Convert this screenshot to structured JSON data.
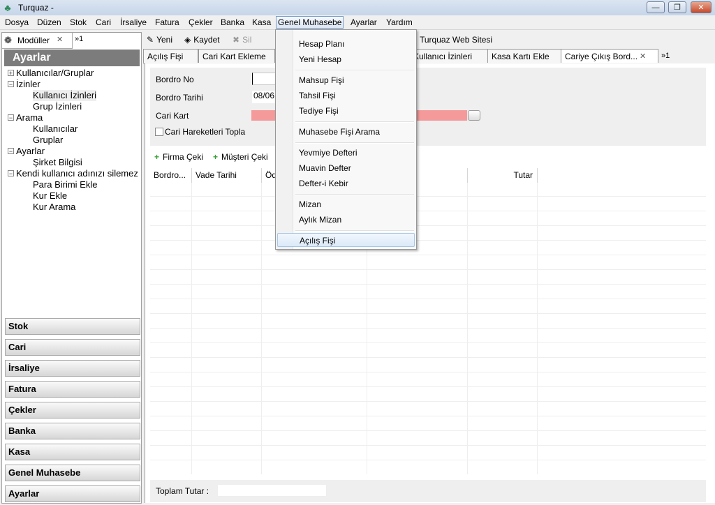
{
  "window": {
    "title": "Turquaz -",
    "minimize": "—",
    "maximize": "❐",
    "close": "✕"
  },
  "menubar": [
    "Dosya",
    "Düzen",
    "Stok",
    "Cari",
    "İrsaliye",
    "Fatura",
    "Çekler",
    "Banka",
    "Kasa",
    "Genel Muhasebe",
    "Ayarlar",
    "Yardım"
  ],
  "left": {
    "tab_label": "Modüller",
    "tab_overflow": "»1",
    "header": "Ayarlar",
    "tree": [
      {
        "label": "Kullanıcılar/Gruplar",
        "expander": "+"
      },
      {
        "label": "İzinler",
        "expander": "−"
      },
      {
        "label": "Kullanıcı İzinleri"
      },
      {
        "label": "Grup İzinleri"
      },
      {
        "label": "Arama",
        "expander": "−"
      },
      {
        "label": "Kullanıcılar"
      },
      {
        "label": "Gruplar"
      },
      {
        "label": "Ayarlar",
        "expander": "−"
      },
      {
        "label": "Şirket Bilgisi"
      },
      {
        "label": "Kendi kullanıcı adınızı silemez",
        "expander": "−"
      },
      {
        "label": "Para Birimi Ekle"
      },
      {
        "label": "Kur Ekle"
      },
      {
        "label": "Kur Arama"
      }
    ],
    "categories": [
      "Stok",
      "Cari",
      "İrsaliye",
      "Fatura",
      "Çekler",
      "Banka",
      "Kasa",
      "Genel Muhasebe",
      "Ayarlar"
    ]
  },
  "toolbar": {
    "new": "Yeni",
    "save": "Kaydet",
    "delete": "Sil",
    "website": "Turquaz Web Sitesi"
  },
  "tabs": [
    "Açılış Fişi",
    "Cari Kart Ekleme",
    "Kullanıcı İzinleri",
    "Kasa Kartı Ekle",
    "Cariye Çıkış Bord...",
    "»1"
  ],
  "form": {
    "bordro_no_label": "Bordro No",
    "bordro_no_value": "",
    "bordro_tarihi_label": "Bordro Tarihi",
    "bordro_tarihi_value": "08/06",
    "cari_kart_label": "Cari Kart",
    "cari_hareket_label": "Cari Hareketleri Topla"
  },
  "actions": {
    "firma_ceki": "Firma Çeki",
    "musteri_ceki": "Müşteri Çeki"
  },
  "table": {
    "columns": [
      "Bordro...",
      "Vade Tarihi",
      "Öd",
      "",
      "Tutar"
    ]
  },
  "footer": {
    "total_label": "Toplam Tutar :",
    "total_value": ""
  },
  "dropdown": {
    "items": [
      "Hesap Planı",
      "Yeni Hesap",
      "Mahsup Fişi",
      "Tahsil Fişi",
      "Tediye Fişi",
      "Muhasebe Fişi Arama",
      "Yevmiye Defteri",
      "Muavin Defter",
      "Defter-i Kebir",
      "Mizan",
      "Aylık Mizan",
      "Açılış Fişi"
    ],
    "highlighted": "Açılış Fişi"
  },
  "colors": {
    "required_field": "#f49a9a",
    "section_header": "#7c7c7c",
    "add_icon": "#3aa13a"
  }
}
